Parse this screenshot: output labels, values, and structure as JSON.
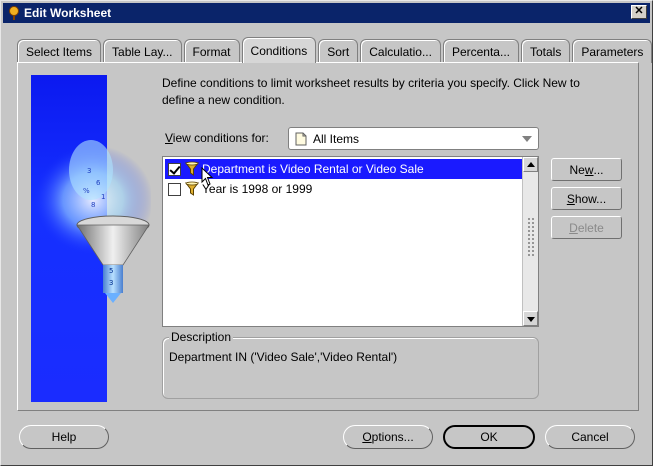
{
  "window": {
    "title": "Edit Worksheet",
    "close_glyph": "✕"
  },
  "tabs": [
    {
      "label": "Select Items"
    },
    {
      "label": "Table Lay..."
    },
    {
      "label": "Format"
    },
    {
      "label": "Conditions",
      "active": true
    },
    {
      "label": "Sort"
    },
    {
      "label": "Calculatio..."
    },
    {
      "label": "Percenta..."
    },
    {
      "label": "Totals"
    },
    {
      "label": "Parameters"
    }
  ],
  "intro": "Define conditions to limit worksheet results by criteria you specify. Click New to define a new condition.",
  "view_conditions": {
    "label_prefix": "V",
    "label_rest": "iew conditions for:",
    "selected": "All Items",
    "icon": "document-icon"
  },
  "conditions": [
    {
      "label": "Department is Video Rental or Video Sale",
      "checked": true,
      "selected": true,
      "icon": "funnel-icon"
    },
    {
      "label": "Year is 1998 or 1999",
      "checked": false,
      "selected": false,
      "icon": "funnel-icon"
    }
  ],
  "side_buttons": {
    "new": {
      "label_pre": "Ne",
      "label_u": "w",
      "label_post": "..."
    },
    "show": {
      "label_pre": "",
      "label_u": "S",
      "label_post": "how..."
    },
    "delete": {
      "label_pre": "",
      "label_u": "D",
      "label_post": "elete",
      "disabled": true
    }
  },
  "description": {
    "legend": "Description",
    "text": "Department IN ('Video Sale','Video Rental')"
  },
  "footer": {
    "help": "Help",
    "options": {
      "label_pre": "",
      "label_u": "O",
      "label_post": "ptions..."
    },
    "ok": "OK",
    "cancel": "Cancel"
  },
  "colors": {
    "title_bar": "#0a246a",
    "selection": "#1a1aff",
    "art_panel": "#0b19f0"
  }
}
